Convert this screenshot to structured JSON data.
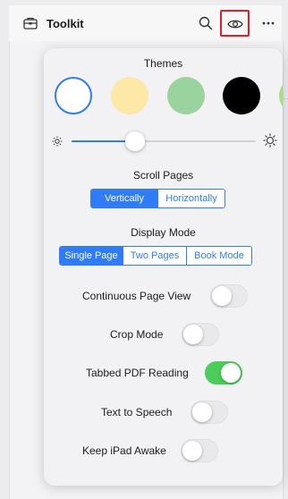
{
  "toolbar": {
    "title": "Toolkit",
    "icons": [
      "toolkit-icon",
      "search-icon",
      "eye-icon",
      "more-icon"
    ]
  },
  "popover": {
    "themes_title": "Themes",
    "themes": [
      {
        "name": "white",
        "color": "#ffffff",
        "selected": true
      },
      {
        "name": "cream",
        "color": "#fde8a8",
        "selected": false
      },
      {
        "name": "green",
        "color": "#9bd39f",
        "selected": false
      },
      {
        "name": "black",
        "color": "#000000",
        "selected": false
      },
      {
        "name": "lime",
        "color": "#a8e07a",
        "selected": false
      }
    ],
    "brightness": 0.35,
    "scroll_title": "Scroll Pages",
    "scroll_options": [
      "Vertically",
      "Horizontally"
    ],
    "scroll_selected": "Vertically",
    "display_title": "Display Mode",
    "display_options": [
      "Single Page",
      "Two Pages",
      "Book Mode"
    ],
    "display_selected": "Single Page",
    "toggles": [
      {
        "label": "Continuous Page View",
        "on": false
      },
      {
        "label": "Crop Mode",
        "on": false
      },
      {
        "label": "Tabbed PDF Reading",
        "on": true
      },
      {
        "label": "Text to Speech",
        "on": false
      },
      {
        "label": "Keep iPad Awake",
        "on": false
      }
    ]
  },
  "colors": {
    "accent": "#2f7cf6",
    "toggle_on": "#4ccc5a",
    "highlight_border": "#e01f26"
  }
}
